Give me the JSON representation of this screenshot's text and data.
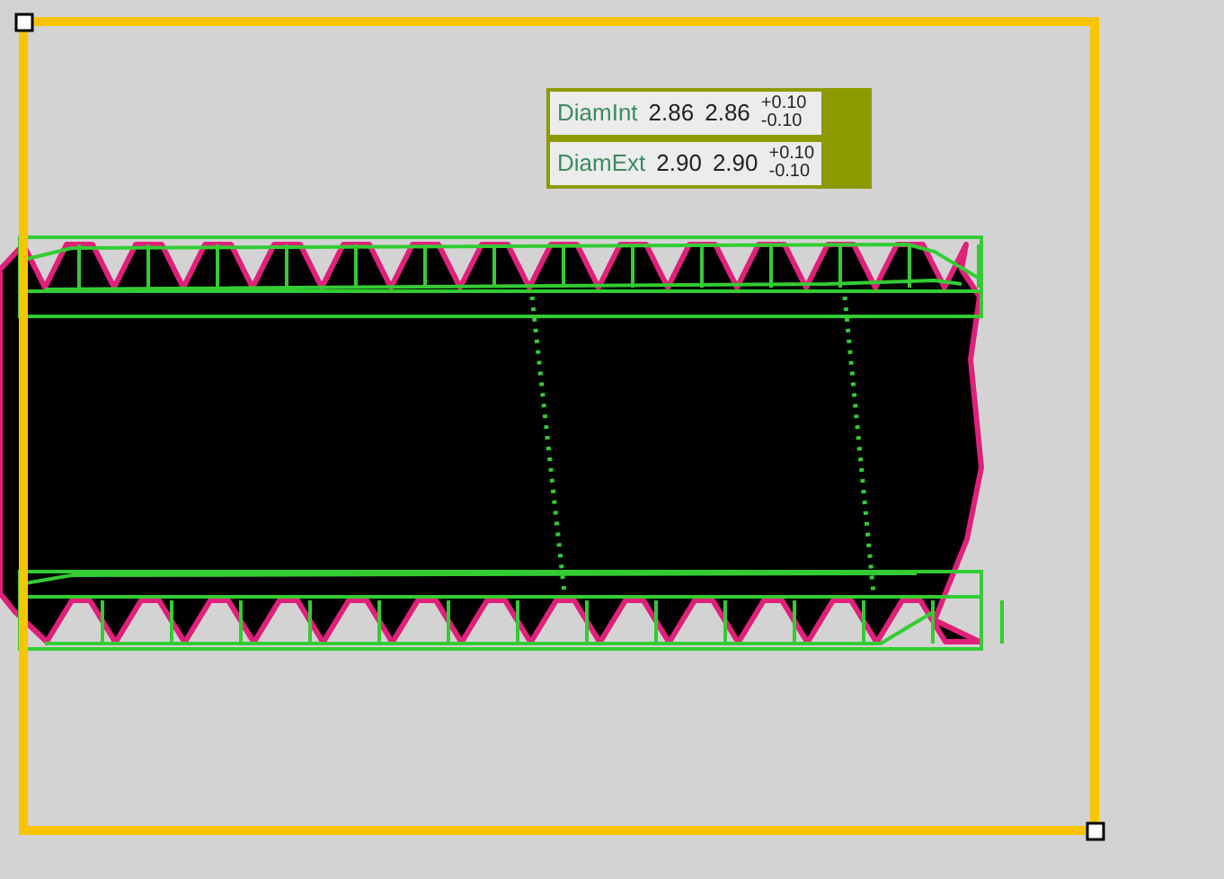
{
  "measurements": [
    {
      "name": "DiamInt",
      "value": "2.86",
      "nominal": "2.86",
      "tol_plus": "+0.10",
      "tol_minus": "-0.10"
    },
    {
      "name": "DiamExt",
      "value": "2.90",
      "nominal": "2.90",
      "tol_plus": "+0.10",
      "tol_minus": "-0.10"
    }
  ]
}
